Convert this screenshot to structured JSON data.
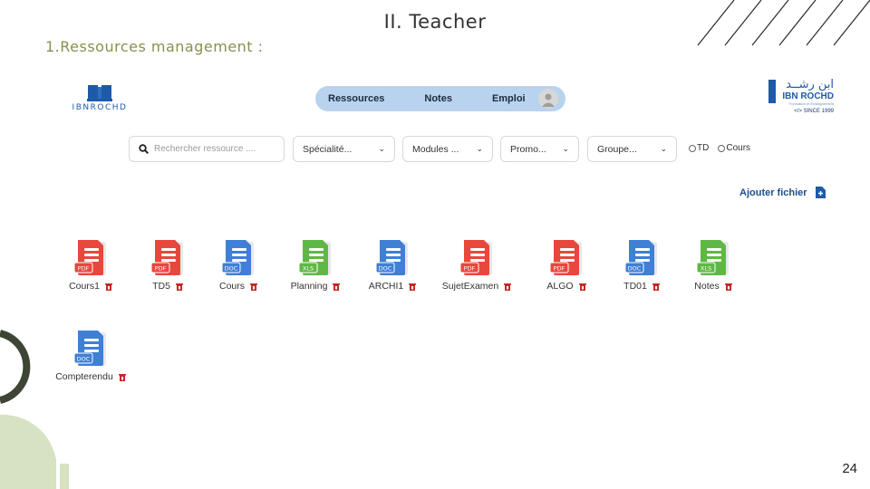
{
  "slide": {
    "title": "II.  Teacher",
    "subtitle": "1.Ressources management :",
    "page_number": "24"
  },
  "logo_left": {
    "text": "IBNROCHD",
    "icon": "book-icon"
  },
  "logo_right": {
    "arabic": "ابن رشــد",
    "name": "IBN ROCHD",
    "tagline": "Formation et Enseignement",
    "since": "</> SINCE  1999"
  },
  "nav": {
    "items": [
      "Ressources",
      "Notes",
      "Emploi"
    ],
    "avatar_icon": "user-avatar-icon"
  },
  "filters": {
    "search_placeholder": "Rechercher ressource ....",
    "specialite": "Spécialité...",
    "modules": "Modules ...",
    "promo": "Promo...",
    "groupe": "Groupe...",
    "radio_td": "TD",
    "radio_cours": "Cours"
  },
  "actions": {
    "add_file": "Ajouter fichier"
  },
  "colors": {
    "pdf": "#e8473c",
    "doc": "#3f7fd6",
    "xls": "#5fb845",
    "trash": "#c62828",
    "nav_bg": "#b9d3ee",
    "accent": "#1e5aa8"
  },
  "files": [
    {
      "name": "Cours1",
      "type": "PDF"
    },
    {
      "name": "TD5",
      "type": "PDF"
    },
    {
      "name": "Cours",
      "type": "DOC"
    },
    {
      "name": "Planning",
      "type": "XLS"
    },
    {
      "name": "ARCHI1",
      "type": "DOC"
    },
    {
      "name": "SujetExamen",
      "type": "PDF"
    },
    {
      "name": "ALGO",
      "type": "PDF"
    },
    {
      "name": "TD01",
      "type": "DOC"
    },
    {
      "name": "Notes",
      "type": "XLS"
    },
    {
      "name": "Compterendu",
      "type": "DOC"
    }
  ]
}
